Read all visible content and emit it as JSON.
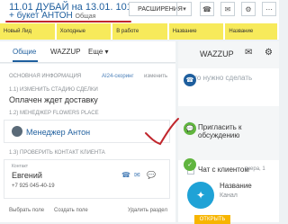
{
  "header": {
    "title": "11.01 ДУБАЙ на 13.01. 101роза",
    "subtitle": "+ букет АНТОН",
    "subtitle_small": "Общая",
    "ext_label": "РАСШИРЕНИЯ",
    "ext_caret": "▾",
    "icons": [
      "phone-icon",
      "mail-icon",
      "settings-icon",
      "more-icon"
    ]
  },
  "stages": [
    "Новый Лид",
    "Холодные",
    "В работе",
    "Название",
    "Название"
  ],
  "tabs": {
    "items": [
      "Общие",
      "WAZZUP",
      "Еще"
    ],
    "more_caret": "▾"
  },
  "left": {
    "section1": "ОСНОВНАЯ ИНФОРМАЦИЯ",
    "ai_tag": "AI24-скоринг",
    "edit": "изменить",
    "stage_label": "1.1) ИЗМЕНИТЬ СТАДИЮ СДЕЛКИ",
    "stage_value": "Оплачен ждет доставку",
    "manager_label": "1.2) МЕНЕДЖЕР FLOWERS PLACE",
    "manager_name": "Менеджер Антон",
    "client_label": "1.3) ПРОВЕРИТЬ КОНТАКТ КЛИЕНТА",
    "contact_label": "Контакт",
    "contact_name": "Евгений",
    "contact_phone": "+7 925 045-40-19",
    "footer": {
      "pick": "Выбрать поле",
      "create": "Создать поле",
      "delete": "Удалить раздел"
    }
  },
  "right": {
    "tab": "WAZZUP",
    "placeholder": "Что нужно сделать",
    "invite": "Пригласить к обсуждению",
    "chat_label": "Чат с клиентом",
    "chat_small": "вчера, 1",
    "channel_title": "Название",
    "channel_sub": "Канал",
    "open": "ОТКРЫТЬ"
  },
  "colors": {
    "accent": "#1f5f9e",
    "stage": "#f7ea5b",
    "danger": "#c1272d",
    "open": "#f7b500"
  }
}
